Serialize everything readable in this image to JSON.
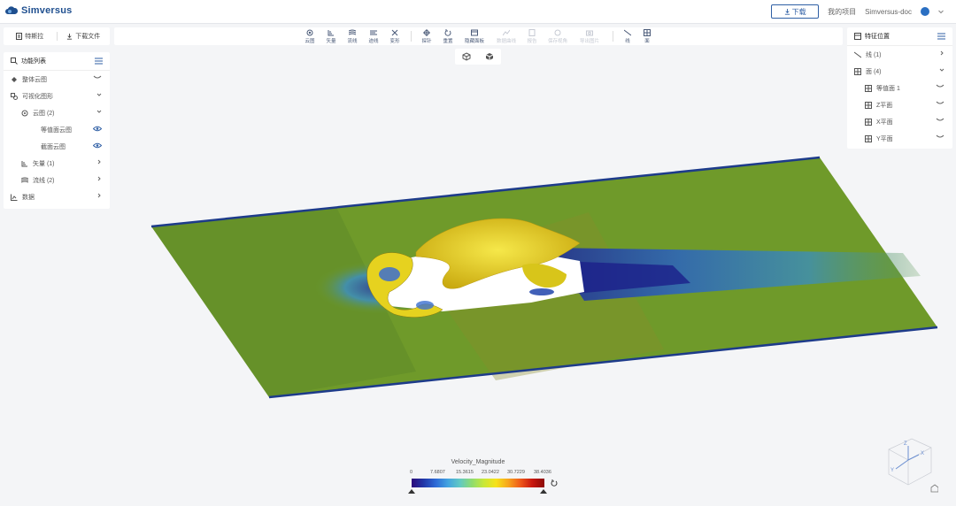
{
  "app": {
    "name": "Simversus",
    "logo_icon": "cloud-logo-icon"
  },
  "header": {
    "download_button": "下载",
    "my_projects": "我的项目",
    "user": "Simversus-doc"
  },
  "left_top": {
    "screenshot": "特斯拉",
    "download_file": "下载文件"
  },
  "toolbar": {
    "items": [
      {
        "label": "云图",
        "icon": "contour-icon",
        "enabled": true
      },
      {
        "label": "矢量",
        "icon": "vector-icon",
        "enabled": true
      },
      {
        "label": "流线",
        "icon": "streamline-icon",
        "enabled": true
      },
      {
        "label": "迹线",
        "icon": "pathline-icon",
        "enabled": true
      },
      {
        "label": "变形",
        "icon": "deform-icon",
        "enabled": true
      },
      {
        "label": "探针",
        "icon": "probe-icon",
        "enabled": true
      },
      {
        "label": "重置",
        "icon": "reset-icon",
        "enabled": true
      },
      {
        "label": "隐藏面板",
        "icon": "panel-icon",
        "enabled": true
      },
      {
        "label": "数据曲线",
        "icon": "curve-icon",
        "enabled": false
      },
      {
        "label": "报告",
        "icon": "report-icon",
        "enabled": false
      },
      {
        "label": "保存视角",
        "icon": "view-icon",
        "enabled": false
      },
      {
        "label": "导出图片",
        "icon": "camera-icon",
        "enabled": false
      },
      {
        "label": "线",
        "icon": "line-icon",
        "enabled": true
      },
      {
        "label": "面",
        "icon": "plane-icon",
        "enabled": true
      }
    ]
  },
  "left_panel": {
    "title": "功能列表",
    "rows": [
      {
        "label": "整体云图",
        "icon": "fill-icon"
      },
      {
        "label": "可视化图形",
        "icon": "shapes-icon"
      },
      {
        "label": "云图 (2)",
        "icon": "contour-icon"
      },
      {
        "label": "等值面云图",
        "icon": ""
      },
      {
        "label": "截面云图",
        "icon": ""
      },
      {
        "label": "矢量 (1)",
        "icon": "vector-icon"
      },
      {
        "label": "流线 (2)",
        "icon": "streamline-icon"
      },
      {
        "label": "数据",
        "icon": "chart-icon"
      }
    ]
  },
  "right_panel": {
    "title": "特征位置",
    "rows": [
      {
        "label": "线 (1)",
        "icon": "line-icon"
      },
      {
        "label": "面 (4)",
        "icon": "grid-icon"
      },
      {
        "label": "等值面 1",
        "icon": "grid-icon"
      },
      {
        "label": "Z平面",
        "icon": "grid-icon"
      },
      {
        "label": "X平面",
        "icon": "grid-icon"
      },
      {
        "label": "Y平面",
        "icon": "grid-icon"
      }
    ]
  },
  "legend": {
    "title": "Velocity_Magnitude",
    "ticks": [
      "0",
      "7.6807",
      "15.3615",
      "23.0422",
      "30.7229",
      "38.4036"
    ]
  },
  "colors": {
    "accent": "#2f5fa5",
    "plate": "#6f9a2a",
    "edge": "#1d3b8a",
    "iso": "#e8d425"
  }
}
